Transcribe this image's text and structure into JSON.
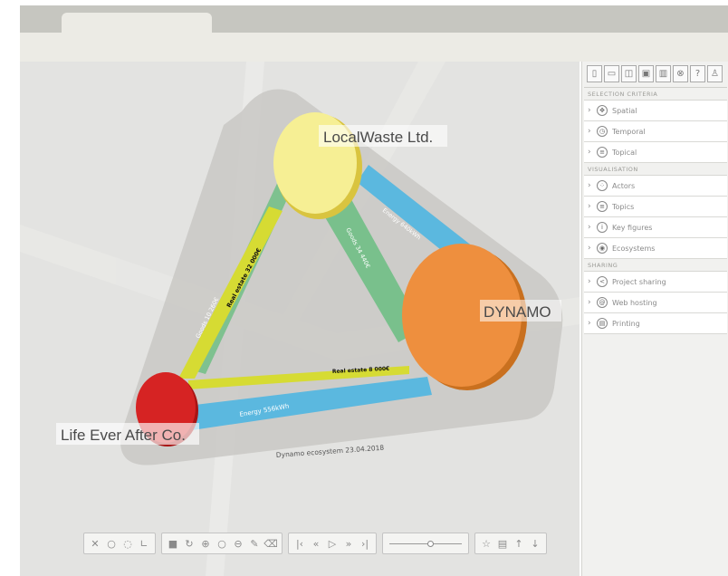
{
  "diagram": {
    "actors": {
      "localwaste": "LocalWaste Ltd.",
      "dynamo": "DYNAMO",
      "lifeever": "Life Ever After Co."
    },
    "flows": {
      "energy_dynamo_localwaste": "Energy 640kWh",
      "goods_localwaste_dynamo": "Goods 34 440€",
      "realestate_localwaste_life": "Real estate 32 000€",
      "goods_life_localwaste": "Goods 10 260€",
      "realestate_life_dynamo": "Real estate 8 000€",
      "energy_dynamo_life": "Energy 556kWh"
    },
    "caption": "Dynamo ecosystem 23.04.2018",
    "colors": {
      "localwaste": "#f6ef94",
      "dynamo": "#ee8f3e",
      "lifeever": "#d62323",
      "energy": "#5bb8df",
      "goods": "#79c08c",
      "realestate": "#d6db33"
    }
  },
  "bottom_toolbar": {
    "groups": [
      [
        "pointer-icon",
        "lasso-icon",
        "pin-icon",
        "angle-icon"
      ],
      [
        "square-icon",
        "rotate-icon",
        "zoom-in-icon",
        "reset-icon",
        "zoom-out-icon",
        "pencil-icon",
        "eraser-icon"
      ],
      [
        "first-icon",
        "rewind-icon",
        "play-icon",
        "fast-forward-icon",
        "last-icon"
      ],
      [
        "star-icon",
        "comment-icon",
        "up-icon",
        "down-icon"
      ]
    ],
    "slider_value": 0.55
  },
  "sidebar": {
    "tools": [
      "new-file-icon",
      "open-folder-icon",
      "database-icon",
      "save-icon",
      "delete-icon",
      "close-icon",
      "help-icon",
      "user-icon"
    ],
    "sections": [
      {
        "title": "SELECTION CRITERIA",
        "items": [
          {
            "label": "Spatial",
            "icon": "move-icon"
          },
          {
            "label": "Temporal",
            "icon": "clock-icon"
          },
          {
            "label": "Topical",
            "icon": "list-icon"
          }
        ]
      },
      {
        "title": "VISUALISATION",
        "items": [
          {
            "label": "Actors",
            "icon": "actors-icon"
          },
          {
            "label": "Topics",
            "icon": "topics-icon"
          },
          {
            "label": "Key figures",
            "icon": "info-icon"
          },
          {
            "label": "Ecosystems",
            "icon": "ecosystems-icon"
          }
        ]
      },
      {
        "title": "SHARING",
        "items": [
          {
            "label": "Project sharing",
            "icon": "share-icon"
          },
          {
            "label": "Web hosting",
            "icon": "web-icon"
          },
          {
            "label": "Printing",
            "icon": "print-icon"
          }
        ]
      }
    ]
  }
}
